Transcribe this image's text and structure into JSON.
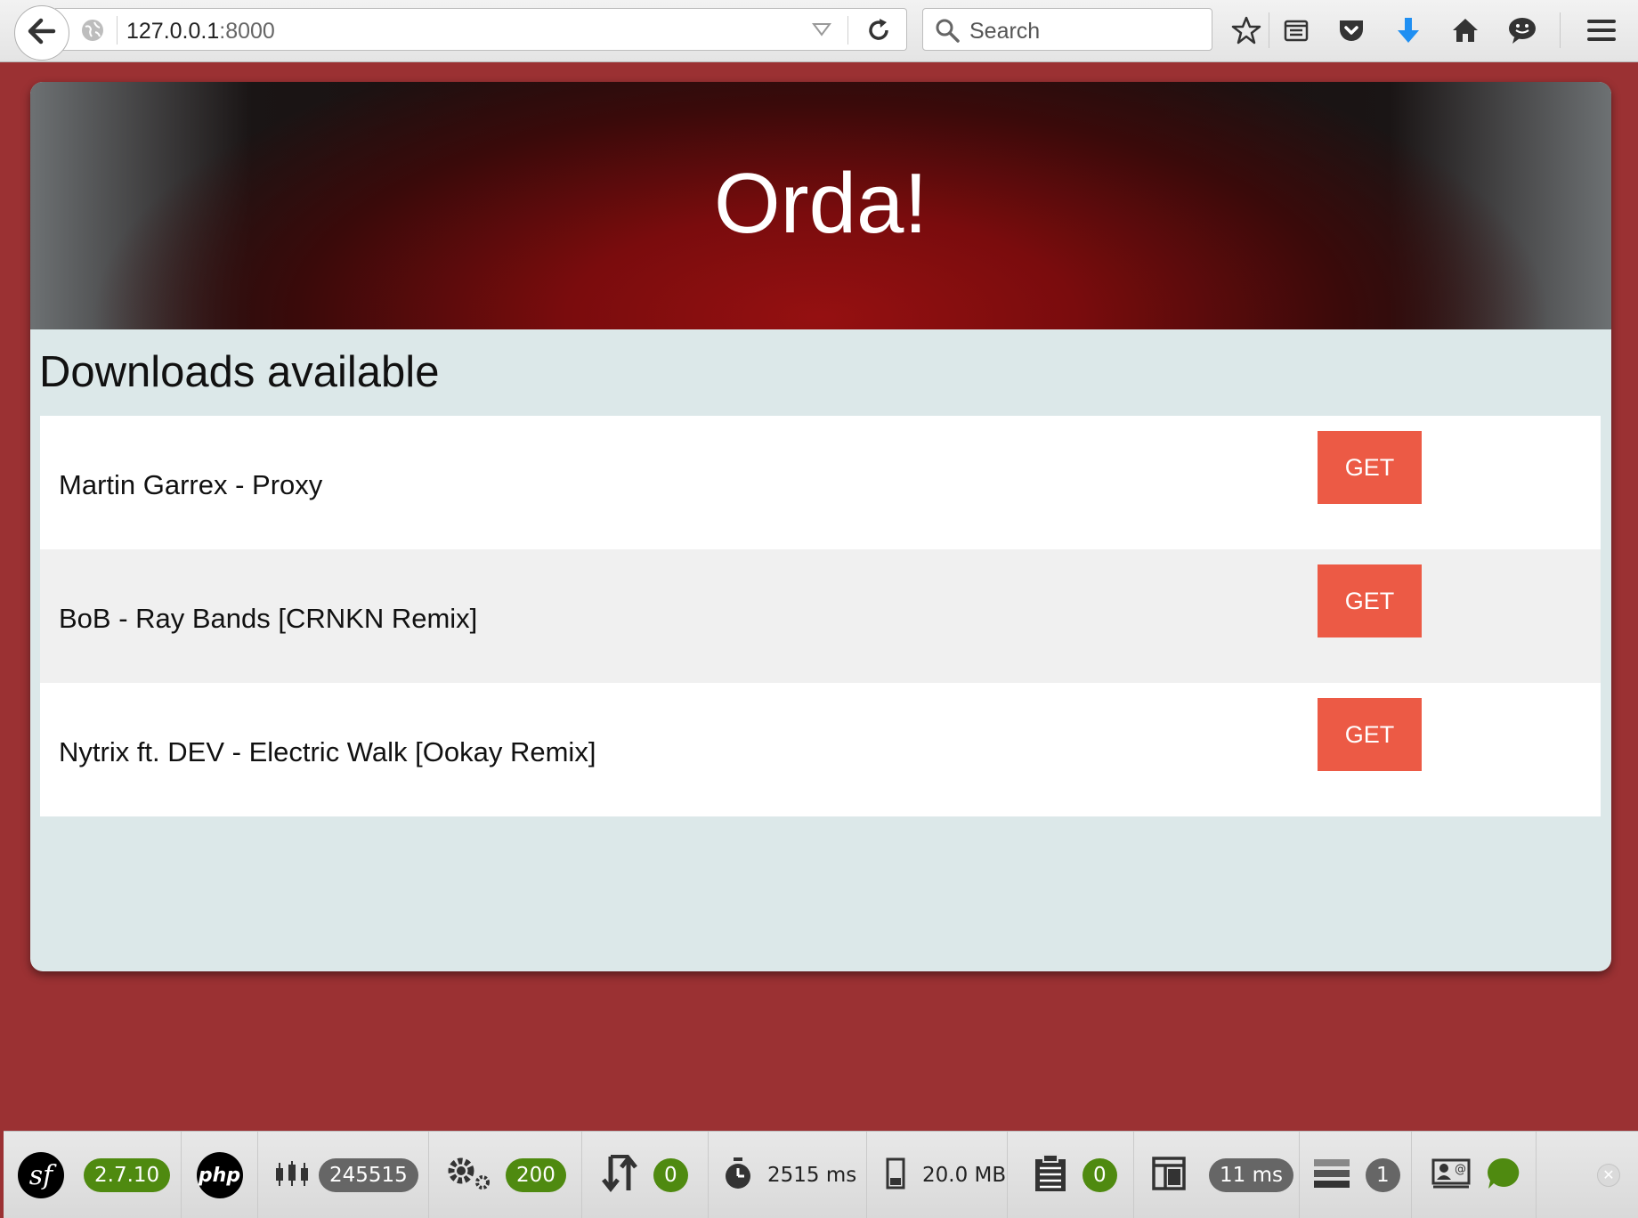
{
  "browser": {
    "url_host": "127.0.0.1",
    "url_port": ":8000",
    "search_placeholder": "Search"
  },
  "page": {
    "title": "Orda!",
    "section_title": "Downloads available",
    "downloads": [
      {
        "label": "Martin Garrex - Proxy",
        "button": "GET"
      },
      {
        "label": "BoB - Ray Bands [CRNKN Remix]",
        "button": "GET"
      },
      {
        "label": "Nytrix ft. DEV - Electric Walk [Ookay Remix]",
        "button": "GET"
      }
    ],
    "accent_color": "#ec5a45",
    "background_color": "#9b3133"
  },
  "debug_toolbar": {
    "logo_text": "sf",
    "version": "2.7.10",
    "php_label": "php",
    "request_token": "245515",
    "status_code": "200",
    "ajax_count": "0",
    "time": "2515 ms",
    "memory": "20.0 MB",
    "logs_count": "0",
    "twig_time": "11 ms",
    "db_queries": "1"
  }
}
